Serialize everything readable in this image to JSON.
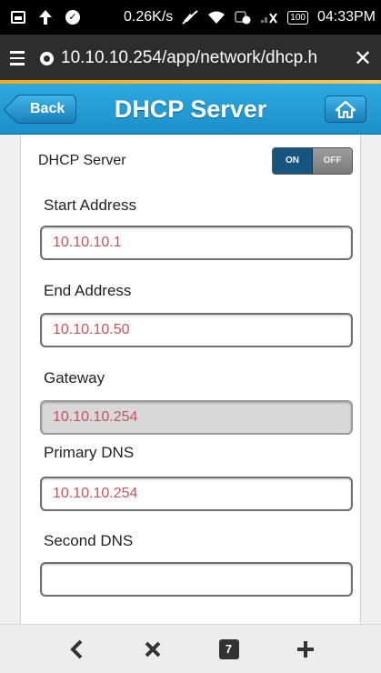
{
  "status_bar": {
    "speed": "0.26K/s",
    "battery": "100",
    "time": "04:33PM"
  },
  "browser": {
    "url": "10.10.10.254/app/network/dhcp.h"
  },
  "header": {
    "back_label": "Back",
    "title": "DHCP Server"
  },
  "form": {
    "dhcp_label": "DHCP Server",
    "toggle_on": "ON",
    "toggle_off": "OFF",
    "start_label": "Start Address",
    "start_value": "10.10.10.1",
    "end_label": "End Address",
    "end_value": "10.10.10.50",
    "gateway_label": "Gateway",
    "gateway_value": "10.10.10.254",
    "primary_dns_label": "Primary DNS",
    "primary_dns_value": "10.10.10.254",
    "second_dns_label": "Second DNS",
    "second_dns_value": ""
  },
  "bottom_bar": {
    "tab_count": "7"
  }
}
